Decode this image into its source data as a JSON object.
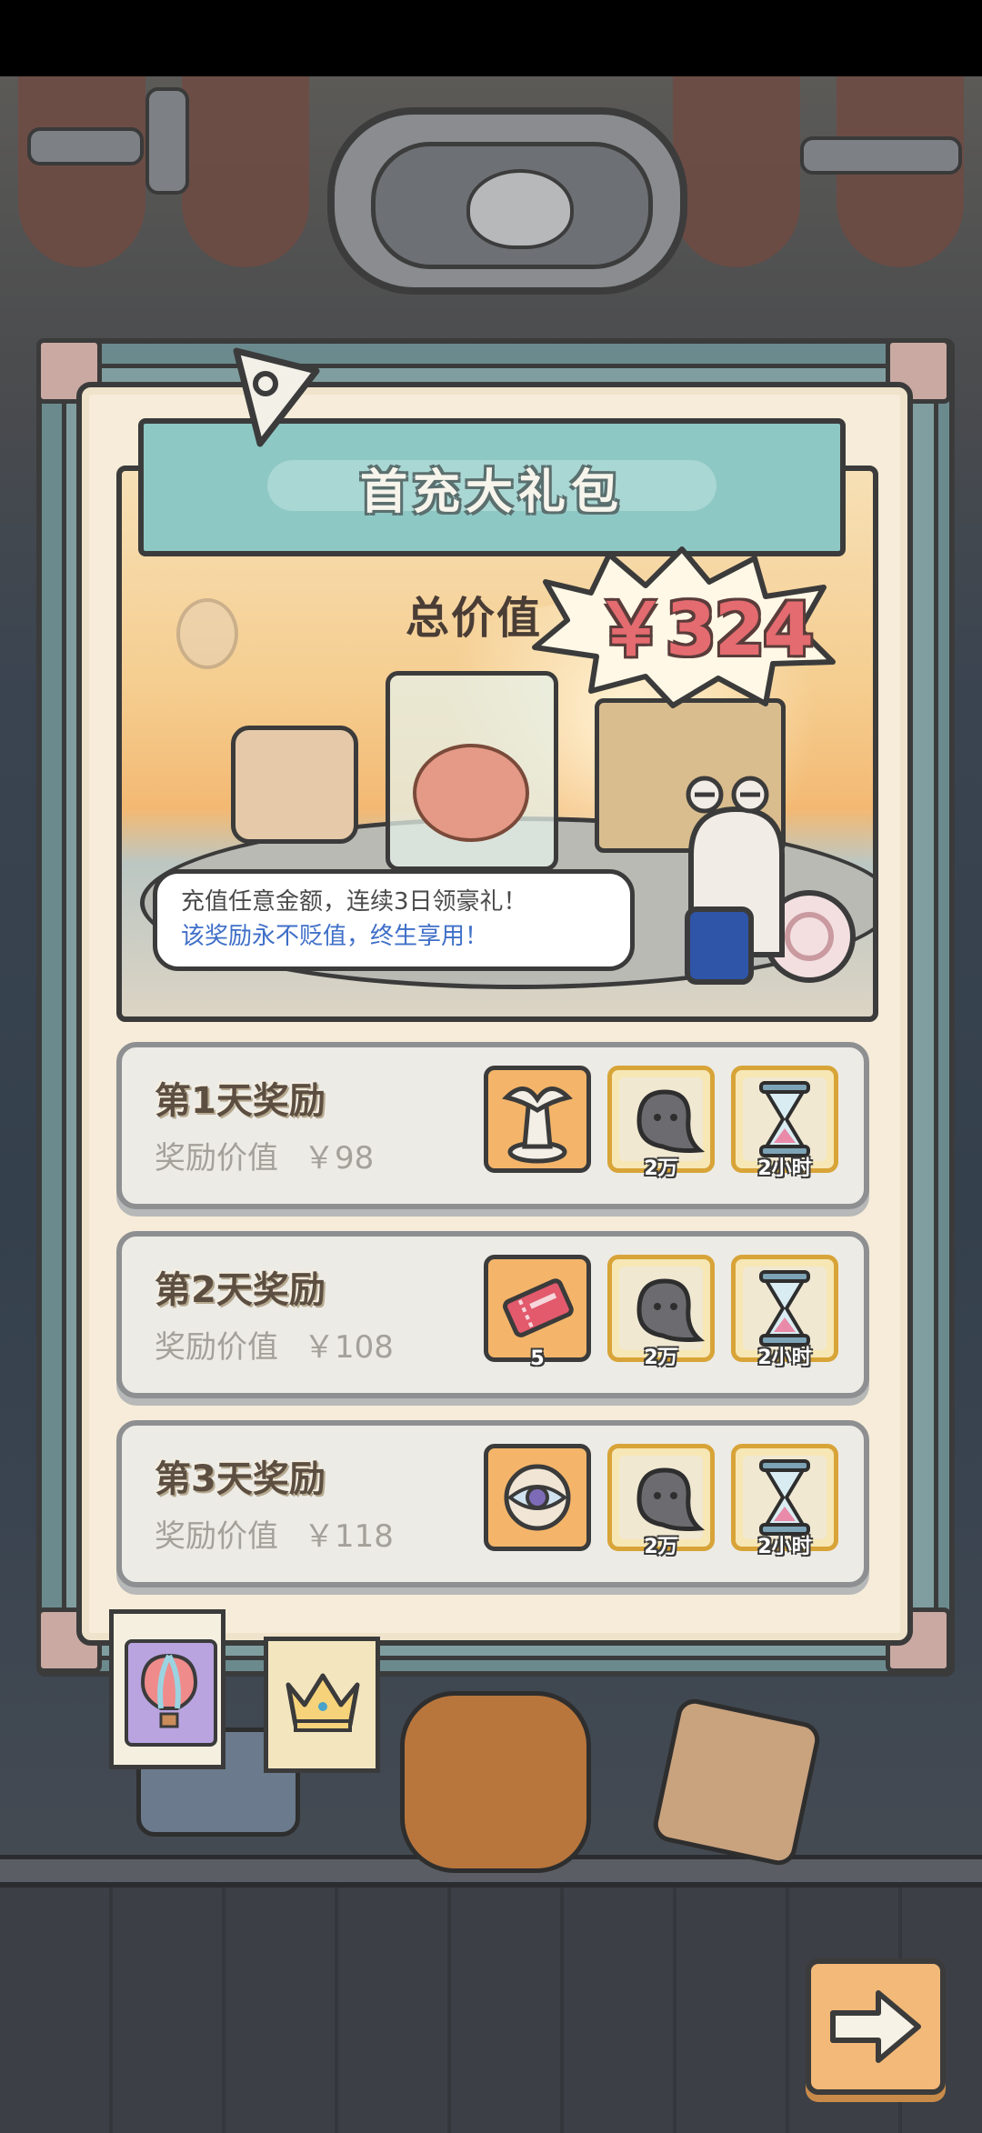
{
  "banner": {
    "title": "首充大礼包"
  },
  "hero": {
    "total_label": "总价值",
    "total_value": "￥324",
    "bubble_line1": "充值任意金额，连续3日领豪礼！",
    "bubble_line2": "该奖励永不贬值，终生享用！"
  },
  "rewards": [
    {
      "title": "第1天奖励",
      "worth_label": "奖励价值",
      "worth_value": "￥98",
      "items": [
        {
          "icon": "statue-icon",
          "qty": ""
        },
        {
          "icon": "ghost-blob-icon",
          "qty": "2万"
        },
        {
          "icon": "hourglass-icon",
          "qty": "2小时"
        }
      ]
    },
    {
      "title": "第2天奖励",
      "worth_label": "奖励价值",
      "worth_value": "￥108",
      "items": [
        {
          "icon": "ticket-icon",
          "qty": "5"
        },
        {
          "icon": "ghost-blob-icon",
          "qty": "2万"
        },
        {
          "icon": "hourglass-icon",
          "qty": "2小时"
        }
      ]
    },
    {
      "title": "第3天奖励",
      "worth_label": "奖励价值",
      "worth_value": "￥118",
      "items": [
        {
          "icon": "eye-orb-icon",
          "qty": ""
        },
        {
          "icon": "ghost-blob-icon",
          "qty": "2万"
        },
        {
          "icon": "hourglass-icon",
          "qty": "2小时"
        }
      ]
    }
  ],
  "tabs": [
    {
      "icon": "hot-air-balloon-icon",
      "selected": true
    },
    {
      "icon": "crown-icon",
      "selected": false
    }
  ],
  "colors": {
    "price_red": "#e46b6f",
    "banner_teal": "#8ec8c5",
    "bubble_blue_text": "#3f6fc8",
    "card_cream": "#f6ecd9"
  }
}
